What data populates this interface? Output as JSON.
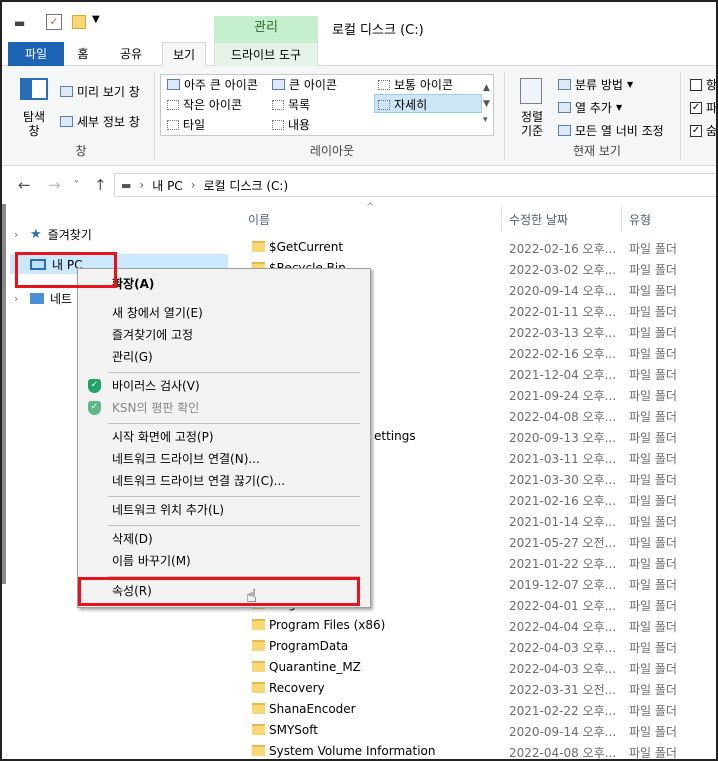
{
  "window": {
    "title": "로컬 디스크 (C:)",
    "context_tab": "관리"
  },
  "tabs": [
    "파일",
    "홈",
    "공유",
    "보기",
    "드라이브 도구"
  ],
  "ribbon": {
    "pane": {
      "nav_pane_label": "탐색\n창",
      "preview": "미리 보기 창",
      "details": "세부 정보 창",
      "group": "창"
    },
    "layout": {
      "items": [
        "아주 큰 아이콘",
        "큰 아이콘",
        "보통 아이콘",
        "작은 아이콘",
        "목록",
        "자세히",
        "타일",
        "내용"
      ],
      "group": "레이아웃"
    },
    "current_view": {
      "sort": "정렬\n기준",
      "group_by": "분류 방법",
      "add_column": "열 추가",
      "size_columns": "모든 열 너비 조정",
      "group": "현재 보기"
    },
    "show_hide": {
      "items": [
        "항",
        "파",
        "숨"
      ]
    }
  },
  "address": {
    "crumbs": [
      "내 PC",
      "로컬 디스크 (C:)"
    ]
  },
  "nav": {
    "favorites": "즐겨찾기",
    "this_pc": "내 PC",
    "network": "네트"
  },
  "columns": {
    "name": "이름",
    "date": "수정한 날짜",
    "type": "유형"
  },
  "files": [
    {
      "name": "$GetCurrent",
      "date": "2022-02-16 오후...",
      "type": "파일 폴더"
    },
    {
      "name": "$Recycle.Bin",
      "date": "2022-03-02 오후...",
      "type": "파일 폴더"
    },
    {
      "name": "",
      "date": "2020-09-14 오후...",
      "type": "파일 폴더"
    },
    {
      "name": "",
      "date": "2022-01-11 오후...",
      "type": "파일 폴더"
    },
    {
      "name": "",
      "date": "2022-03-13 오후...",
      "type": "파일 폴더"
    },
    {
      "name": "",
      "date": "2022-02-16 오후...",
      "type": "파일 폴더"
    },
    {
      "name": "",
      "date": "2021-12-04 오후...",
      "type": "파일 폴더"
    },
    {
      "name": "",
      "date": "2021-09-24 오후...",
      "type": "파일 폴더"
    },
    {
      "name": "",
      "date": "2022-04-08 오후...",
      "type": "파일 폴더"
    },
    {
      "name": "ettings",
      "date": "2020-09-13 오후...",
      "type": "파일 폴더"
    },
    {
      "name": "",
      "date": "2021-03-11 오후...",
      "type": "파일 폴더"
    },
    {
      "name": "",
      "date": "2021-03-30 오후...",
      "type": "파일 폴더"
    },
    {
      "name": "",
      "date": "2021-02-16 오후...",
      "type": "파일 폴더"
    },
    {
      "name": "",
      "date": "2021-01-14 오후...",
      "type": "파일 폴더"
    },
    {
      "name": "",
      "date": "2021-05-27 오전...",
      "type": "파일 폴더"
    },
    {
      "name": "",
      "date": "2021-01-22 오후...",
      "type": "파일 폴더"
    },
    {
      "name": "",
      "date": "2019-12-07 오후...",
      "type": "파일 폴더"
    },
    {
      "name": "Program Files",
      "date": "2022-04-01 오후...",
      "type": "파일 폴더"
    },
    {
      "name": "Program Files (x86)",
      "date": "2022-04-04 오후...",
      "type": "파일 폴더"
    },
    {
      "name": "ProgramData",
      "date": "2022-04-03 오후...",
      "type": "파일 폴더"
    },
    {
      "name": "Quarantine_MZ",
      "date": "2022-04-03 오후...",
      "type": "파일 폴더"
    },
    {
      "name": "Recovery",
      "date": "2022-03-31 오전...",
      "type": "파일 폴더"
    },
    {
      "name": "ShanaEncoder",
      "date": "2021-02-22 오후...",
      "type": "파일 폴더"
    },
    {
      "name": "SMYSoft",
      "date": "2020-09-14 오후...",
      "type": "파일 폴더"
    },
    {
      "name": "System Volume Information",
      "date": "2022-04-08 오후...",
      "type": "파일 폴더"
    }
  ],
  "context_menu": {
    "expand": "확장(A)",
    "open_new_window": "새 창에서 열기(E)",
    "pin_quick": "즐겨찾기에 고정",
    "manage": "관리(G)",
    "virus_scan": "바이러스 검사(V)",
    "ksn": "KSN의 평판 확인",
    "pin_start": "시작 화면에 고정(P)",
    "map_drive": "네트워크 드라이브 연결(N)...",
    "disconnect_drive": "네트워크 드라이브 연결 끊기(C)...",
    "add_net_location": "네트워크 위치 추가(L)",
    "delete": "삭제(D)",
    "rename": "이름 바꾸기(M)",
    "properties": "속성(R)"
  },
  "colors": {
    "highlight": "#e8121a",
    "file_tab": "#1e64b4",
    "manage_tab": "#c6efce"
  }
}
